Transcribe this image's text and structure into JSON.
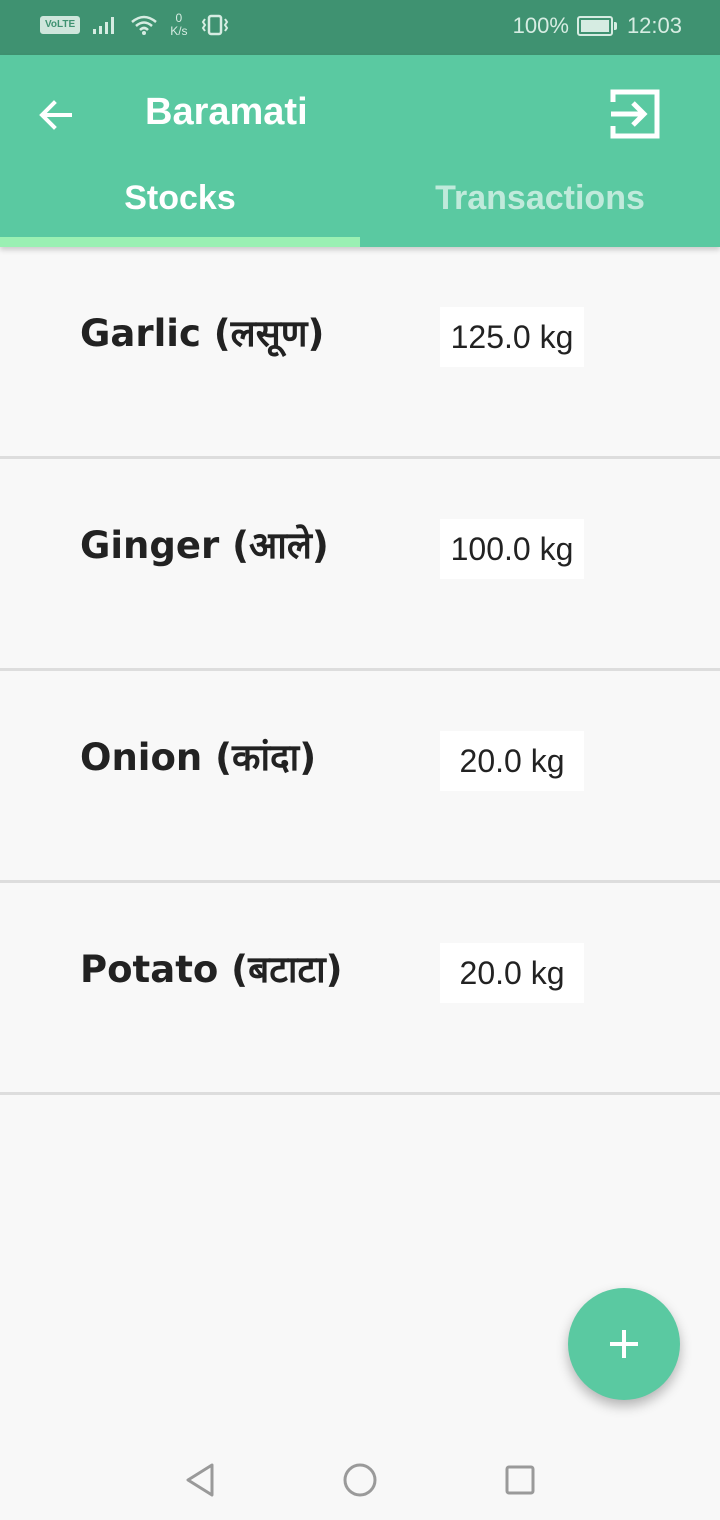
{
  "status_bar": {
    "network_badge": "VoLTE",
    "speed_value": "0",
    "speed_unit": "K/s",
    "battery": "100%",
    "time": "12:03",
    "icons": [
      "signal-icon",
      "wifi-icon",
      "vibrate-icon",
      "battery-icon"
    ]
  },
  "app_bar": {
    "title": "Baramati",
    "back_icon": "arrow-left-icon",
    "logout_icon": "exit-icon"
  },
  "tabs": [
    {
      "label": "Stocks",
      "selected": true
    },
    {
      "label": "Transactions",
      "selected": false
    }
  ],
  "stocks": [
    {
      "name": "Garlic (लसूण)",
      "quantity": "125.0 kg"
    },
    {
      "name": "Ginger (आले)",
      "quantity": "100.0 kg"
    },
    {
      "name": "Onion (कांदा)",
      "quantity": "20.0 kg"
    },
    {
      "name": "Potato (बटाटा)",
      "quantity": "20.0 kg"
    }
  ],
  "fab": {
    "icon": "plus-icon"
  },
  "nav_bar": {
    "icons": [
      "back-triangle-icon",
      "home-circle-icon",
      "recents-square-icon"
    ]
  },
  "colors": {
    "primary": "#5ac9a1",
    "status_bar": "#3f9271",
    "tab_indicator": "#9af0b3",
    "background": "#f8f8f8"
  }
}
